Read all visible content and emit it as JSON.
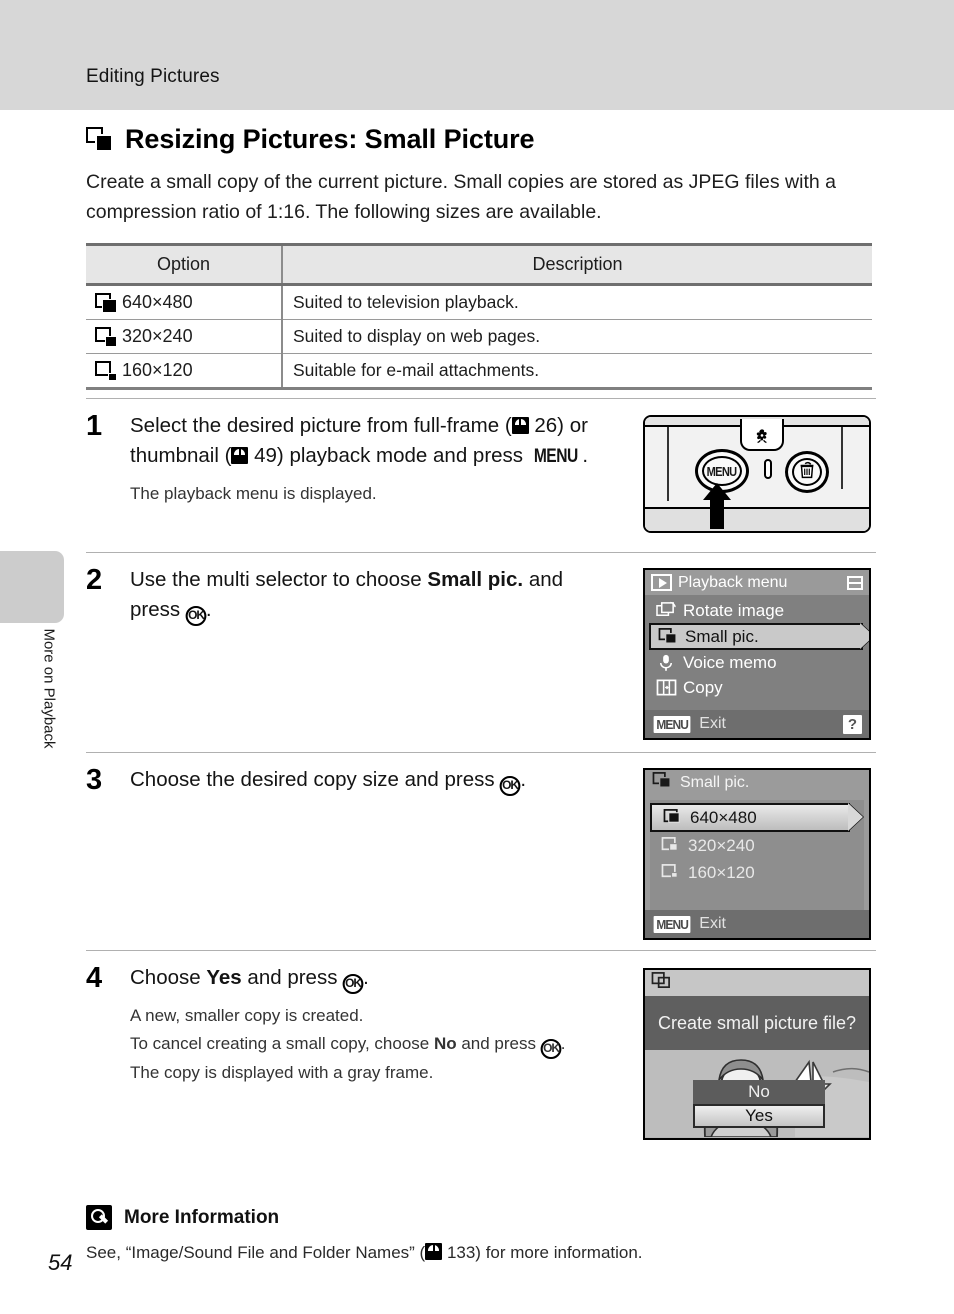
{
  "header": {
    "running_title": "Editing Pictures"
  },
  "side_tab": {
    "label": "More on Playback"
  },
  "heading": {
    "title": "Resizing Pictures: Small Picture",
    "icon": "small-picture-icon"
  },
  "intro": "Create a small copy of the current picture. Small copies are stored as JPEG files with a compression ratio of 1:16. The following sizes are available.",
  "table": {
    "columns": [
      "Option",
      "Description"
    ],
    "rows": [
      {
        "icon": "small-picture-640-icon",
        "option": "640×480",
        "description": "Suited to television playback."
      },
      {
        "icon": "small-picture-320-icon",
        "option": "320×240",
        "description": "Suited to display on web pages."
      },
      {
        "icon": "small-picture-160-icon",
        "option": "160×120",
        "description": "Suitable for e-mail attachments."
      }
    ]
  },
  "steps": [
    {
      "number": "1",
      "main_parts": [
        "Select the desired picture from full-frame (",
        "ref",
        " 26) or thumbnail (",
        "ref",
        " 49) playback mode and press ",
        "MENU",
        "."
      ],
      "main_plain": "Select the desired picture from full-frame ( 26) or thumbnail ( 49) playback mode and press MENU.",
      "sub": [
        "The playback menu is displayed."
      ],
      "figure": "camera-back-illustration"
    },
    {
      "number": "2",
      "main_plain": "Use the multi selector to choose Small pic. and press OK.",
      "bold_terms": [
        "Small pic."
      ],
      "sub": [],
      "figure": "playback-menu-screen"
    },
    {
      "number": "3",
      "main_plain": "Choose the desired copy size and press OK.",
      "sub": [],
      "figure": "small-pic-size-screen"
    },
    {
      "number": "4",
      "main_plain": "Choose Yes and press OK.",
      "bold_terms": [
        "Yes"
      ],
      "sub": [
        "A new, smaller copy is created.",
        "To cancel creating a small copy, choose No and press OK.",
        "The copy is displayed with a gray frame."
      ],
      "figure": "create-small-picture-confirm-screen"
    }
  ],
  "step1_text": {
    "p1": "Select the desired picture from full-frame (",
    "p2": " 26) or thumbnail (",
    "p3": " 49) playback mode",
    "p4": "and press ",
    "menu": "MENU",
    "p5": ".",
    "sub": "The playback menu is displayed."
  },
  "step2_text": {
    "p1": "Use the multi selector to choose ",
    "bold": "Small pic.",
    "p2": "and press ",
    "p3": "."
  },
  "step3_text": {
    "p1": "Choose the desired copy size and press ",
    "p2": "."
  },
  "step4_text": {
    "p1": "Choose ",
    "bold": "Yes",
    "p2": " and press ",
    "p3": ".",
    "sub1": "A new, smaller copy is created.",
    "sub2a": "To cancel creating a small copy, choose ",
    "sub2b": "No",
    "sub2c": " and press ",
    "sub2d": ".",
    "sub3": "The copy is displayed with a gray frame."
  },
  "camera_figure": {
    "menu_button_label": "MENU",
    "macro_icon": "macro-flower-icon",
    "delete_icon": "trash-can-icon",
    "pointer_icon": "up-arrow-icon"
  },
  "playback_menu_screen": {
    "title": "Playback menu",
    "title_icon": "playback-icon",
    "corner_icon": "menu-tab-icon",
    "items": [
      {
        "label": "Rotate image",
        "icon": "rotate-image-icon",
        "selected": false
      },
      {
        "label": "Small pic.",
        "icon": "small-picture-icon",
        "selected": true
      },
      {
        "label": "Voice memo",
        "icon": "microphone-icon",
        "selected": false
      },
      {
        "label": "Copy",
        "icon": "copy-icon",
        "selected": false
      }
    ],
    "bottom": {
      "menu_key": "MENU",
      "action": "Exit",
      "help": "?"
    }
  },
  "small_pic_screen": {
    "title": "Small pic.",
    "title_icon": "small-picture-icon",
    "options": [
      {
        "label": "640×480",
        "icon": "small-picture-640-icon",
        "selected": true
      },
      {
        "label": "320×240",
        "icon": "small-picture-320-icon",
        "selected": false
      },
      {
        "label": "160×120",
        "icon": "small-picture-160-icon",
        "selected": false
      }
    ],
    "bottom": {
      "menu_key": "MENU",
      "action": "Exit"
    }
  },
  "confirm_screen": {
    "title_icon": "small-picture-icon",
    "message": "Create small picture file?",
    "buttons": [
      {
        "label": "No",
        "selected": false
      },
      {
        "label": "Yes",
        "selected": true
      }
    ]
  },
  "more_information": {
    "icon": "key-note-icon",
    "title": "More Information",
    "text_before": "See, “Image/Sound File and Folder Names” (",
    "text_after": " 133) for more information."
  },
  "page_number": "54",
  "colors": {
    "header_band": "#d7d7d7",
    "side_tab": "#cccccc",
    "table_header": "#e6e6e6",
    "lcd_background": "#808080",
    "lcd_selected": "#c9c9c9"
  }
}
